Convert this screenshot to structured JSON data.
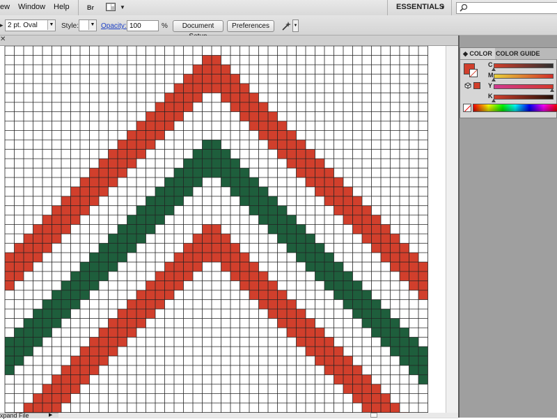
{
  "menu": {
    "items": [
      {
        "name": "menu-view",
        "label": "ew"
      },
      {
        "name": "menu-window",
        "label": "Window"
      },
      {
        "name": "menu-help",
        "label": "Help"
      }
    ],
    "bridge_label": "Br",
    "workspace": "ESSENTIALS"
  },
  "control_bar": {
    "brush_value": "2 pt. Oval",
    "style_label": "Style:",
    "opacity_label": "Opacity:",
    "opacity_value": "100",
    "opacity_unit": "%",
    "document_setup_label": "Document Setup",
    "preferences_label": "Preferences"
  },
  "panel": {
    "tabs": [
      "COLOR",
      "COLOR GUIDE"
    ],
    "channels": [
      {
        "label": "C",
        "level": 0.0
      },
      {
        "label": "M",
        "level": 0.0
      },
      {
        "label": "Y",
        "level": 1.0
      },
      {
        "label": "K",
        "level": 0.0
      }
    ]
  },
  "status": {
    "text": "xpand File"
  },
  "colors": {
    "grid_line": "#222222",
    "red": "#d13f2c",
    "green": "#1e5e3c",
    "fill_swatch": "#d13f2c",
    "panel_bg": "#d6d6d6",
    "accent_link": "#1b3fc5"
  },
  "icons": [
    "close-icon",
    "bridge-icon",
    "arrange-documents-icon",
    "search-icon",
    "brush-icon",
    "stroke-swatch-icon",
    "out-of-gamut-icon",
    "none-swatch-icon"
  ],
  "pattern": {
    "columns": 45,
    "rows": 40,
    "red_band_outer": "red",
    "green_band_middle": "green",
    "red_band_inner": "red"
  }
}
